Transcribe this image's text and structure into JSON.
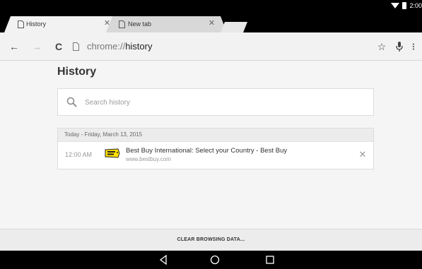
{
  "status": {
    "time": "2:00"
  },
  "tabs": [
    {
      "label": "History",
      "active": true
    },
    {
      "label": "New tab",
      "active": false
    }
  ],
  "toolbar": {
    "back_icon": "arrow-back-icon",
    "forward_icon": "arrow-forward-icon",
    "reload_icon": "reload-icon",
    "url_scheme": "chrome://",
    "url_host": "history",
    "star_icon": "star-icon",
    "mic_icon": "mic-icon",
    "menu_icon": "more-vert-icon"
  },
  "page": {
    "title": "History",
    "search_placeholder": "Search history",
    "search_value": ""
  },
  "history": {
    "day_label": "Today - Friday, March 13, 2015",
    "entries": [
      {
        "time": "12:00 AM",
        "favicon": "best-buy-logo",
        "title": "Best Buy International: Select your Country - Best Buy",
        "domain": "www.bestbuy.com"
      }
    ]
  },
  "footer": {
    "clear_label": "CLEAR BROWSING DATA..."
  },
  "navbar": {
    "back_icon": "nav-back-icon",
    "home_icon": "nav-home-icon",
    "recents_icon": "nav-recents-icon"
  },
  "colors": {
    "tabstrip": "#000000",
    "toolbar": "#f2f2f2",
    "content_bg": "#f5f5f5",
    "bestbuy_yellow": "#ffe000"
  }
}
